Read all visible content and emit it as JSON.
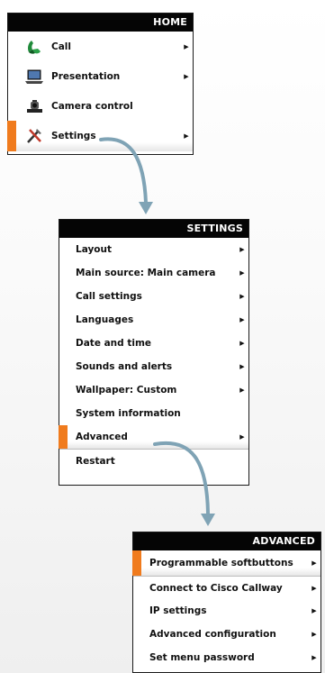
{
  "home": {
    "title": "HOME",
    "items": [
      {
        "label": "Call",
        "icon": "phone-icon",
        "has_submenu": true
      },
      {
        "label": "Presentation",
        "icon": "laptop-icon",
        "has_submenu": true
      },
      {
        "label": "Camera control",
        "icon": "camera-icon",
        "has_submenu": false
      },
      {
        "label": "Settings",
        "icon": "tools-icon",
        "has_submenu": true,
        "selected": true
      }
    ]
  },
  "settings": {
    "title": "SETTINGS",
    "items": [
      {
        "label": "Layout",
        "has_submenu": true
      },
      {
        "label": "Main source: Main camera",
        "has_submenu": true
      },
      {
        "label": "Call settings",
        "has_submenu": true
      },
      {
        "label": "Languages",
        "has_submenu": true
      },
      {
        "label": "Date and time",
        "has_submenu": true
      },
      {
        "label": "Sounds and alerts",
        "has_submenu": true
      },
      {
        "label": "Wallpaper: Custom",
        "has_submenu": true
      },
      {
        "label": "System information",
        "has_submenu": false
      },
      {
        "label": "Advanced",
        "has_submenu": true,
        "selected": true
      },
      {
        "label": "Restart",
        "has_submenu": false
      }
    ]
  },
  "advanced": {
    "title": "ADVANCED",
    "items": [
      {
        "label": "Programmable softbuttons",
        "has_submenu": true,
        "selected": true
      },
      {
        "label": "Connect to Cisco Callway",
        "has_submenu": true
      },
      {
        "label": "IP settings",
        "has_submenu": true
      },
      {
        "label": "Advanced configuration",
        "has_submenu": true
      },
      {
        "label": "Set menu password",
        "has_submenu": true
      }
    ]
  },
  "colors": {
    "accent": "#f07b1d",
    "header_bg": "#050505",
    "connector": "#7fa3b5"
  }
}
